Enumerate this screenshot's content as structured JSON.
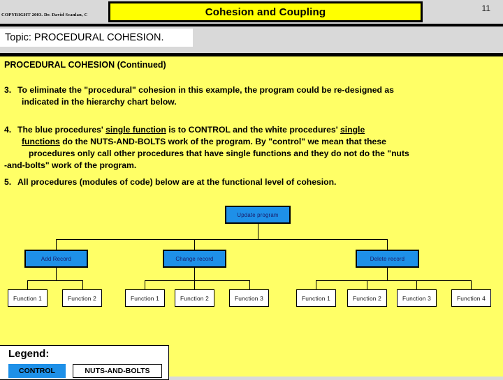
{
  "header": {
    "copyright": "COPYRIGHT 2003. Dr. David Scanlan, C",
    "title": "Cohesion and Coupling",
    "page_number": "11",
    "topic": "Topic: PROCEDURAL COHESION."
  },
  "slide": {
    "subhead": "PROCEDURAL COHESION (Continued)",
    "items": [
      {
        "number": "3.",
        "line1": "To eliminate the \"procedural\" cohesion in this example, the program could be re-designed as",
        "line2": "indicated in the hierarchy chart below."
      },
      {
        "number": "4.",
        "line1_a": "The blue procedures' ",
        "line1_u": "single function",
        "line1_b": " is to CONTROL and the white procedures' ",
        "line1_u2": "single",
        "line2_u": "functions",
        "line2_b": " do the NUTS-AND-BOLTS work of the program.  By \"control\" we mean that these",
        "line3": "procedures   only call other procedures that have single functions and they do not do the  \"nuts",
        "line4": "-and-bolts\" work of the program."
      },
      {
        "number": "5.",
        "line1": "All procedures (modules of code) below are at the functional level of cohesion."
      }
    ]
  },
  "chart_data": {
    "type": "tree",
    "title": "Hierarchy chart of procedures",
    "root": {
      "label": "Update program",
      "kind": "control"
    },
    "level2": [
      {
        "label": "Add Record",
        "kind": "control"
      },
      {
        "label": "Change record",
        "kind": "control"
      },
      {
        "label": "Delete record",
        "kind": "control"
      }
    ],
    "level3": {
      "add_record": [
        "Function 1",
        "Function 2"
      ],
      "change_record": [
        "Function 1",
        "Function 2",
        "Function 3"
      ],
      "delete_record": [
        "Function 1",
        "Function 2",
        "Function 3",
        "Function 4"
      ]
    }
  },
  "legend": {
    "title": "Legend:",
    "control_label": "CONTROL",
    "nuts_label": "NUTS-AND-BOLTS"
  },
  "colors": {
    "slide_background": "#ffff66",
    "header_background": "#d9d9d9",
    "title_background": "#ffff00",
    "control_blue": "#1e90e8",
    "leaf_white": "#ffffff",
    "text": "#000000"
  }
}
